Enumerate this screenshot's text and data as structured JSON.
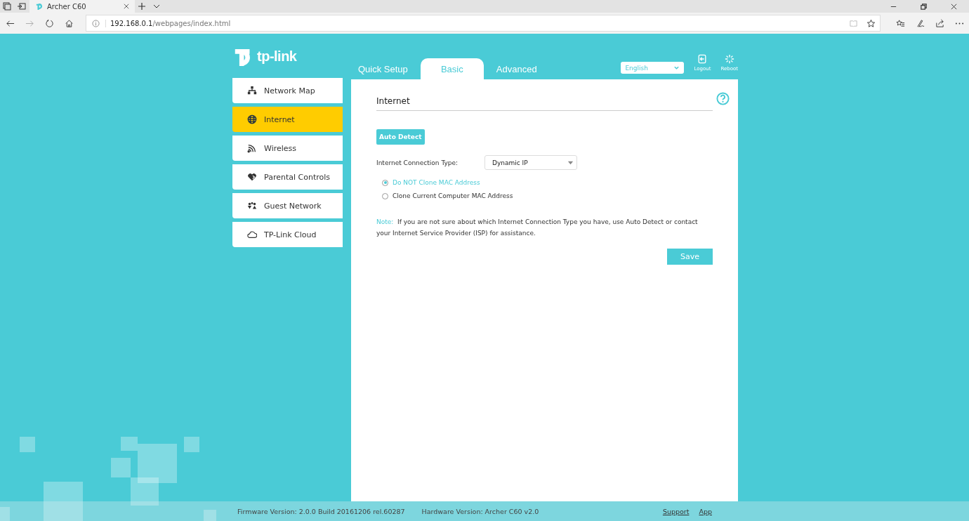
{
  "browser": {
    "tabs": [
      {
        "title": "Archer C60",
        "selected": true
      }
    ],
    "url": {
      "host": "192.168.0.1",
      "path": "/webpages/index.html"
    }
  },
  "header": {
    "logo": "tp-link",
    "nav_tabs": [
      {
        "label": "Quick Setup",
        "selected": false
      },
      {
        "label": "Basic",
        "selected": true
      },
      {
        "label": "Advanced",
        "selected": false
      }
    ],
    "language": {
      "value": "English"
    },
    "actions": [
      {
        "label": "Logout",
        "kind": "logout"
      },
      {
        "label": "Reboot",
        "kind": "reboot"
      }
    ]
  },
  "sidebar": {
    "items": [
      {
        "label": "Network Map",
        "kind": "network",
        "selected": false
      },
      {
        "label": "Internet",
        "kind": "globe",
        "selected": true
      },
      {
        "label": "Wireless",
        "kind": "wireless",
        "selected": false
      },
      {
        "label": "Parental Controls",
        "kind": "heart",
        "selected": false
      },
      {
        "label": "Guest Network",
        "kind": "guests",
        "selected": false
      },
      {
        "label": "TP-Link Cloud",
        "kind": "cloud",
        "selected": false
      }
    ]
  },
  "content": {
    "title": "Internet",
    "auto_detect_button": "Auto Detect",
    "connection_type": {
      "label": "Internet Connection Type:",
      "value": "Dynamic IP"
    },
    "mac_options": [
      {
        "label": "Do NOT Clone MAC Address",
        "selected": true
      },
      {
        "label": "Clone Current Computer MAC Address",
        "selected": false
      }
    ],
    "note": {
      "label": "Note:",
      "text": "If you are not sure about which Internet Connection Type you have, use Auto Detect or contact your Internet Service Provider (ISP) for assistance."
    },
    "save_button": "Save"
  },
  "footer": {
    "firmware": "Firmware Version: 2.0.0 Build 20161206 rel.60287",
    "hardware": "Hardware Version: Archer C60 v2.0",
    "links": [
      "Support",
      "App"
    ]
  }
}
